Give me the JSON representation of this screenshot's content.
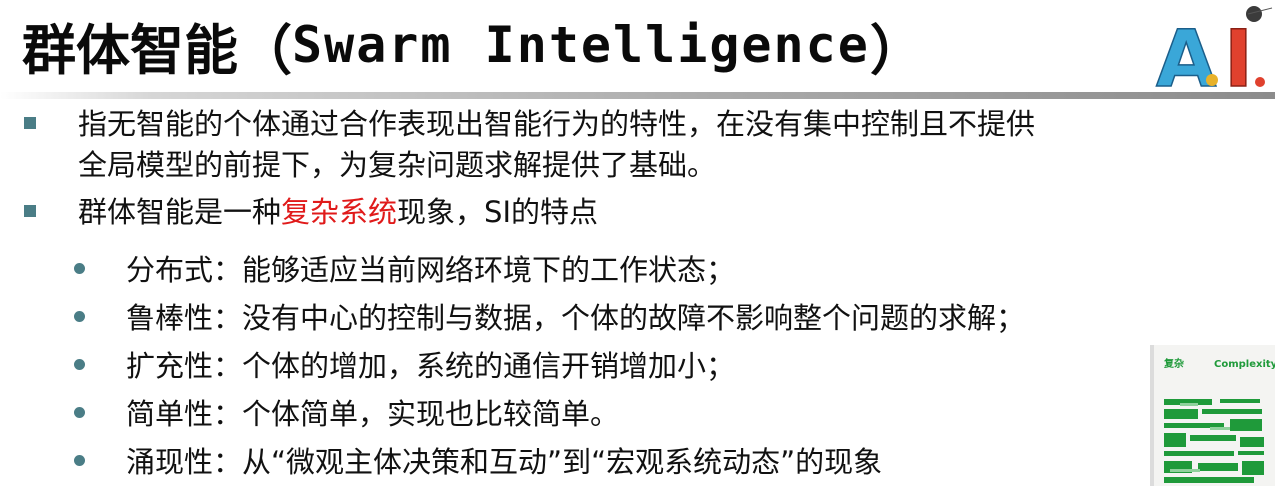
{
  "slide": {
    "title_cn": "群体智能（",
    "title_en": "Swarm Intelligence",
    "title_close": "）",
    "logo_text": "A.I.",
    "points": [
      {
        "text_lines": [
          "指无智能的个体通过合作表现出智能行为的特性，在没有集中控制且不提供",
          "全局模型的前提下，为复杂问题求解提供了基础。"
        ]
      },
      {
        "prefix": "群体智能是一种",
        "highlight": "复杂系统",
        "suffix": "现象，SI的特点"
      }
    ],
    "features": [
      {
        "name": "分布式",
        "sep": "：",
        "desc": "能够适应当前网络环境下的工作状态；"
      },
      {
        "name": "鲁棒性",
        "sep": "：",
        "desc": "没有中心的控制与数据，个体的故障不影响整个问题的求解；"
      },
      {
        "name": "扩充性",
        "sep": "：",
        "desc": "个体的增加，系统的通信开销增加小；"
      },
      {
        "name": "简单性",
        "sep": "：",
        "desc": "个体简单，实现也比较简单。"
      },
      {
        "name": "涌现性",
        "sep": "：",
        "desc": "从“微观主体决策和互动”到“宏观系统动态”的现象"
      }
    ],
    "book": {
      "title_cn": "复杂",
      "title_en": "Complexity"
    }
  },
  "colors": {
    "bullet": "#4a7d86",
    "highlight": "#e01a1a",
    "book_green": "#1f9a3a"
  }
}
